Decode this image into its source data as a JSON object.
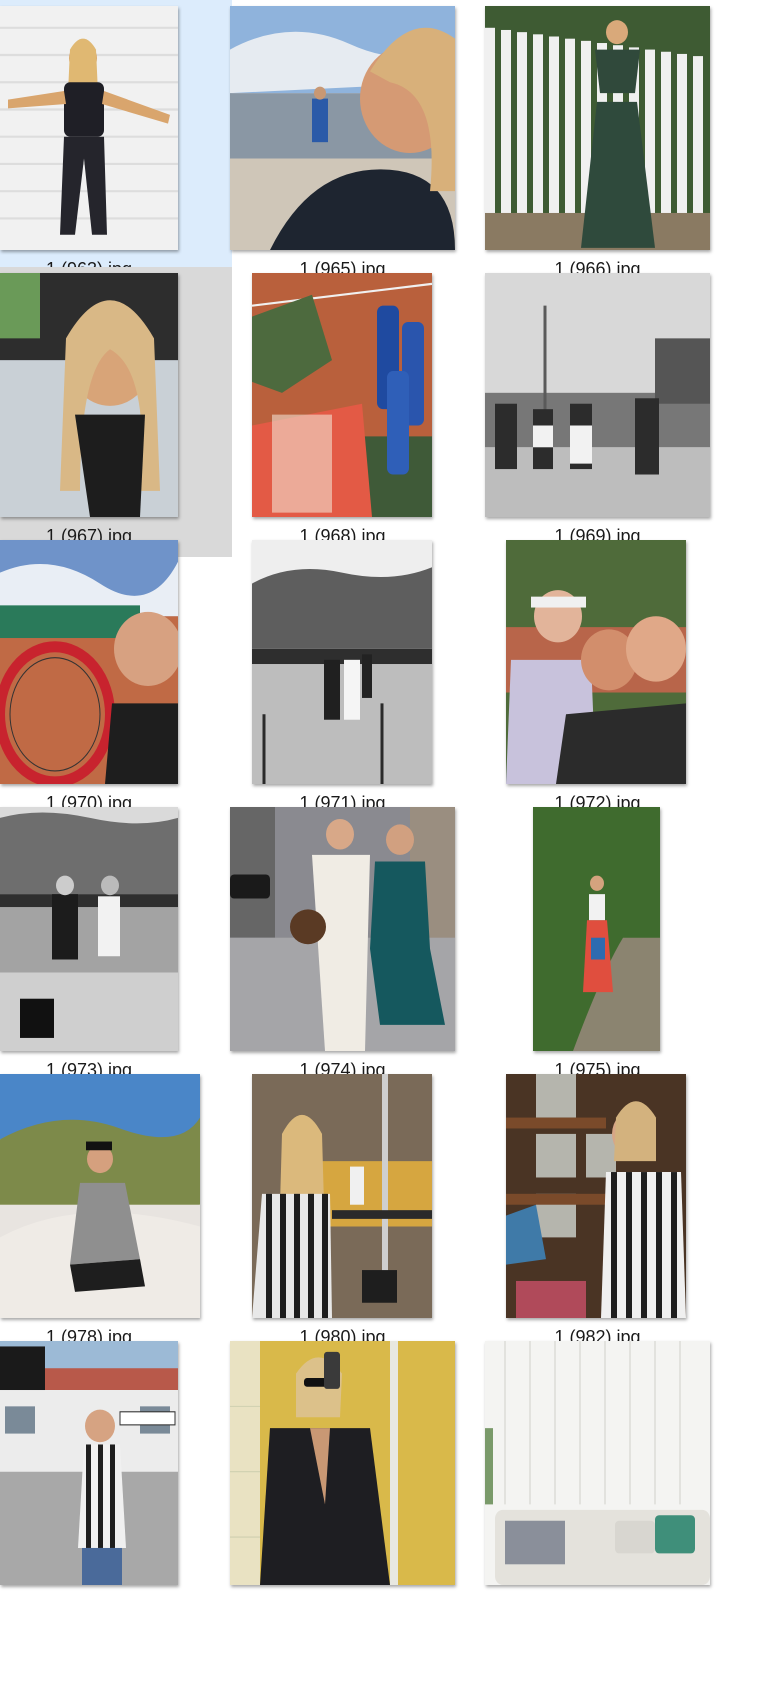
{
  "explorer": {
    "view": "large-icons",
    "selected_index": 0,
    "hover_index": 3,
    "files": [
      {
        "name": "1 (963).jpg",
        "orientation": "portrait",
        "palette": [
          "#f2f2f2",
          "#e0e0e0",
          "#1e1e24",
          "#d9a56d"
        ]
      },
      {
        "name": "1 (965).jpg",
        "orientation": "portrait",
        "palette": [
          "#8fb0d6",
          "#c8c2b8",
          "#1f2630",
          "#d8a078"
        ]
      },
      {
        "name": "1 (966).jpg",
        "orientation": "portrait",
        "palette": [
          "#3d5a32",
          "#eeeeee",
          "#2f4a3c",
          "#8a7a62"
        ]
      },
      {
        "name": "1 (967).jpg",
        "orientation": "portrait",
        "palette": [
          "#2b2b2b",
          "#c9d0d6",
          "#1d1d1d",
          "#d8a478"
        ]
      },
      {
        "name": "1 (968).jpg",
        "orientation": "portrait",
        "palette": [
          "#b9603c",
          "#4d6a3e",
          "#d9533c",
          "#1f4aa0"
        ]
      },
      {
        "name": "1 (969).jpg",
        "orientation": "portrait",
        "palette": [
          "#dcdcdc",
          "#7d7d7d",
          "#2c2c2c",
          "#a9a9a9"
        ]
      },
      {
        "name": "1 (970).jpg",
        "orientation": "portrait",
        "palette": [
          "#6f93c9",
          "#c06a45",
          "#2a7a5a",
          "#c8232e"
        ]
      },
      {
        "name": "1 (971).jpg",
        "orientation": "portrait",
        "palette": [
          "#ededed",
          "#6a6a6a",
          "#bdbdbd",
          "#222222"
        ]
      },
      {
        "name": "1 (972).jpg",
        "orientation": "portrait",
        "palette": [
          "#4f6b3a",
          "#b8654a",
          "#2b2b2b",
          "#d59c7e"
        ]
      },
      {
        "name": "1 (973).jpg",
        "orientation": "portrait",
        "palette": [
          "#dadada",
          "#6e6e6e",
          "#9f9f9f",
          "#1c1c1c"
        ]
      },
      {
        "name": "1 (974).jpg",
        "orientation": "portrait",
        "palette": [
          "#7c7c84",
          "#f0ece4",
          "#15585e",
          "#c79e84"
        ]
      },
      {
        "name": "1 (975).jpg",
        "orientation": "portrait",
        "palette": [
          "#3f6b2e",
          "#8b8470",
          "#e04e3e",
          "#f2f2f2"
        ]
      },
      {
        "name": "1 (978).jpg",
        "orientation": "portrait",
        "palette": [
          "#4a86c8",
          "#7d8a4a",
          "#e8e4e0",
          "#8f8f8f"
        ]
      },
      {
        "name": "1 (980).jpg",
        "orientation": "portrait",
        "palette": [
          "#7a6a58",
          "#d6a640",
          "#2a2a2a",
          "#f0f0f0"
        ]
      },
      {
        "name": "1 (982).jpg",
        "orientation": "portrait",
        "palette": [
          "#4a3424",
          "#b5b5ad",
          "#1e1e1e",
          "#3f7aa8"
        ]
      },
      {
        "name": "",
        "orientation": "portrait",
        "palette": [
          "#c4d4e4",
          "#b8594a",
          "#ececec",
          "#1f3f7a"
        ]
      },
      {
        "name": "",
        "orientation": "portrait",
        "palette": [
          "#d9b94a",
          "#e9e2c2",
          "#1e1e22",
          "#c99874"
        ]
      },
      {
        "name": "",
        "orientation": "portrait",
        "palette": [
          "#f4f4f2",
          "#e4e2dc",
          "#cfcfcb",
          "#3f8f7a"
        ]
      }
    ]
  }
}
